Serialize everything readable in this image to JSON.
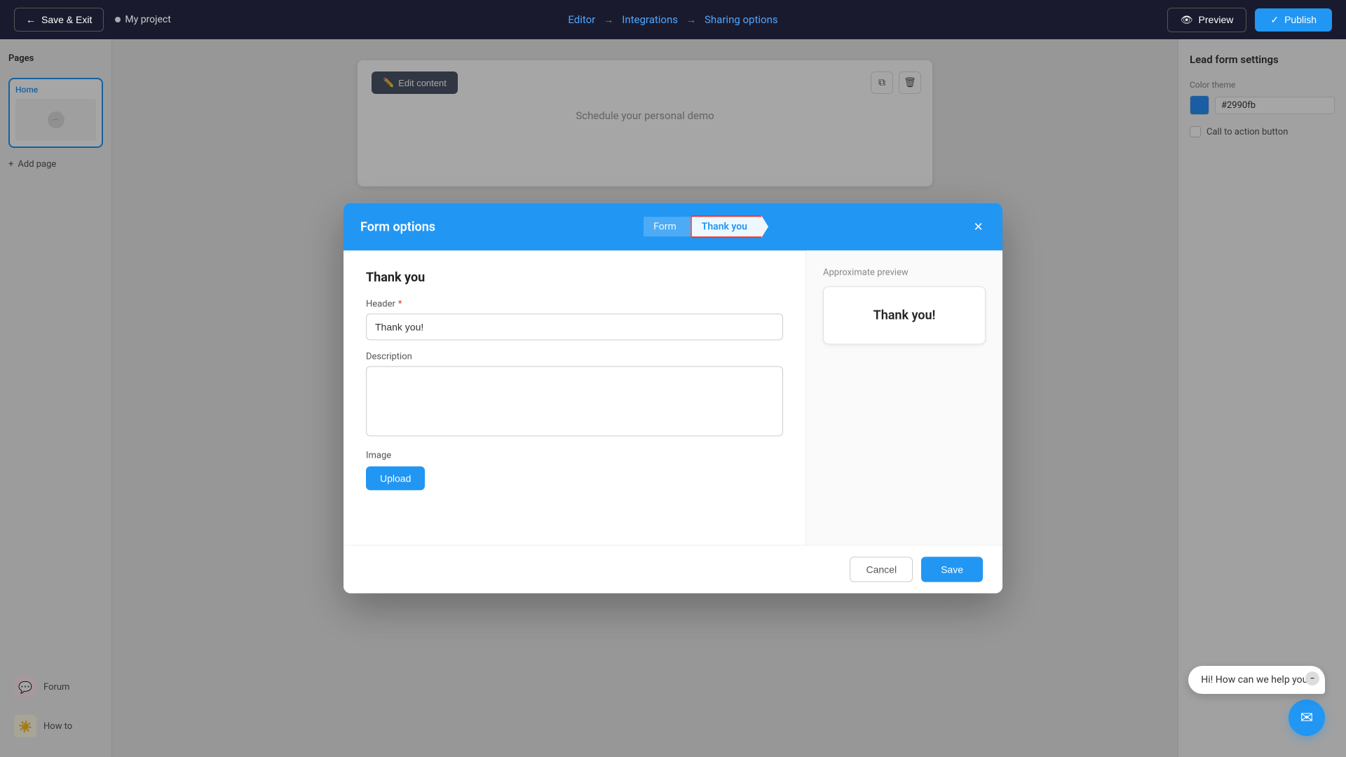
{
  "navbar": {
    "save_exit_label": "Save & Exit",
    "project_name": "My project",
    "steps": [
      {
        "label": "Editor",
        "active": true
      },
      {
        "label": "Integrations",
        "active": false
      },
      {
        "label": "Sharing options",
        "active": false
      }
    ],
    "preview_label": "Preview",
    "publish_label": "Publish"
  },
  "sidebar": {
    "title": "Pages",
    "pages": [
      {
        "label": "Home"
      }
    ],
    "add_page_label": "Add page",
    "tools": [
      {
        "label": "Forum",
        "icon": "💬"
      },
      {
        "label": "How to",
        "icon": "☀️"
      }
    ]
  },
  "canvas": {
    "edit_content_label": "Edit content",
    "schedule_text": "Schedule your personal demo"
  },
  "right_panel": {
    "title": "Lead form settings",
    "color_theme_label": "Color theme",
    "color_value": "#2990fb",
    "cta_button_label": "Call to action button"
  },
  "modal": {
    "title": "Form options",
    "tabs": [
      {
        "label": "Form",
        "active": false
      },
      {
        "label": "Thank you",
        "active": true
      }
    ],
    "close_label": "×",
    "form": {
      "section_title": "Thank you",
      "header_label": "Header",
      "header_required": true,
      "header_value": "Thank you!",
      "description_label": "Description",
      "description_value": "",
      "image_label": "Image",
      "upload_label": "Upload"
    },
    "preview": {
      "label": "Approximate preview",
      "text": "Thank you!"
    },
    "footer": {
      "cancel_label": "Cancel",
      "save_label": "Save"
    }
  },
  "chat": {
    "bubble_text": "Hi! How can we help you?",
    "icon": "💬"
  }
}
